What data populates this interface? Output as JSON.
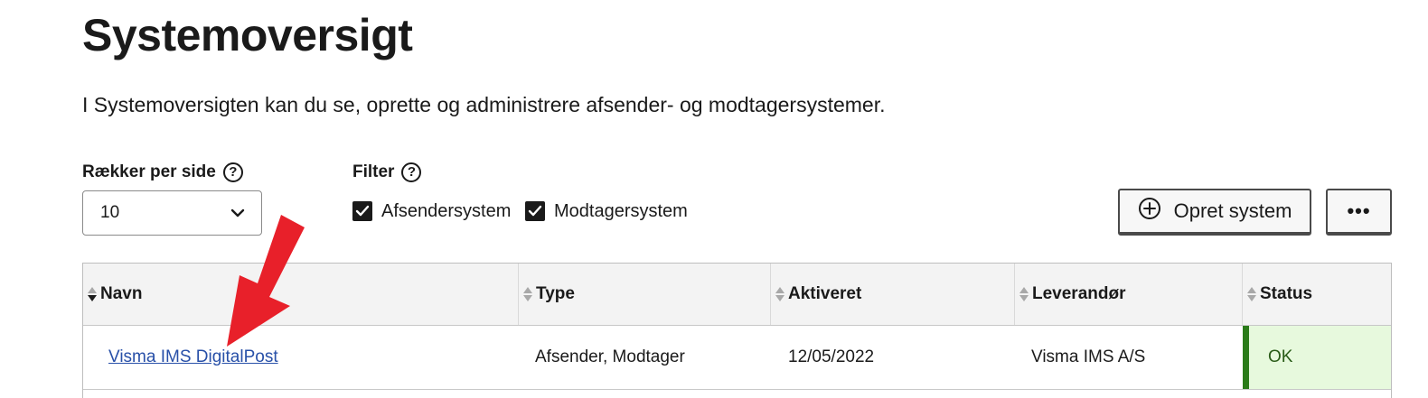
{
  "page": {
    "title": "Systemoversigt",
    "intro": "I Systemoversigten kan du se, oprette og administrere afsender- og modtagersystemer."
  },
  "controls": {
    "rows_label": "Rækker per side",
    "rows_value": "10",
    "filter_label": "Filter",
    "help_glyph": "?",
    "filters": [
      {
        "label": "Afsendersystem",
        "checked": true
      },
      {
        "label": "Modtagersystem",
        "checked": true
      }
    ],
    "create_button": "Opret system",
    "more_button": "•••"
  },
  "table": {
    "columns": [
      "Navn",
      "Type",
      "Aktiveret",
      "Leverandør",
      "Status"
    ],
    "rows": [
      {
        "name": "Visma IMS DigitalPost",
        "type": "Afsender, Modtager",
        "activated": "12/05/2022",
        "vendor": "Visma IMS A/S",
        "status": "OK"
      }
    ]
  },
  "colors": {
    "link": "#2850a8",
    "status_ok_bg": "#e7f9dd",
    "status_ok_bar": "#2a7b18",
    "annotation_arrow": "#e8202a"
  },
  "icons": {
    "help": "help-circle-icon",
    "select": "chevron-down-icon",
    "checkbox": "checkmark-icon",
    "create": "plus-circle-icon",
    "sort": "sort-icon",
    "annotation": "red-arrow-icon"
  }
}
